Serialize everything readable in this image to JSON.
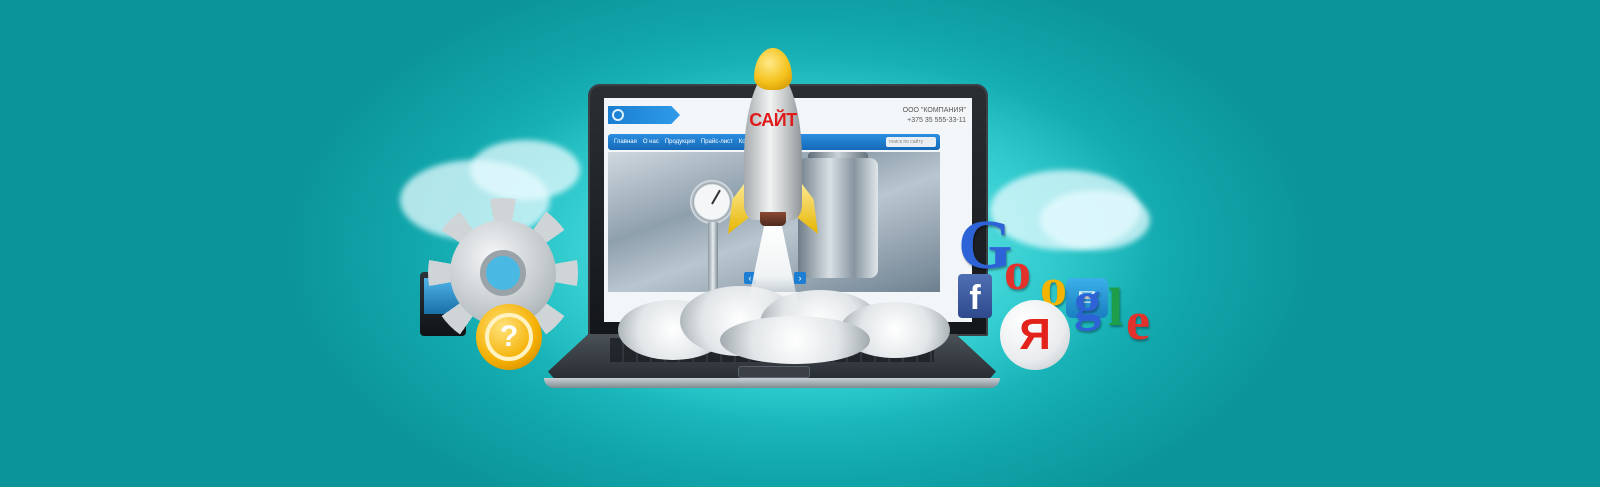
{
  "rocket": {
    "label": "САЙТ"
  },
  "website": {
    "company": "ООО \"КОМПАНИЯ\"",
    "phone": "+375 35 555-33-11",
    "nav": [
      "Главная",
      "О нас",
      "Продукция",
      "Прайс-лист",
      "Кон"
    ],
    "search_placeholder": "поиск по сайту",
    "arrow_prev": "‹",
    "arrow_next": "›"
  },
  "logos": {
    "google": [
      "G",
      "o",
      "o",
      "g",
      "l",
      "e"
    ],
    "facebook": "f",
    "yandex": "Я"
  },
  "icons": [
    "gear-icon",
    "magnifier-icon",
    "question-icon",
    "monitor-icon",
    "facebook-icon",
    "chat-icon",
    "yandex-icon",
    "rocket-icon"
  ],
  "colors": {
    "background": "#1bbcc0",
    "rocket_text": "#e01a1a",
    "nav_bar": "#1f7fcf"
  }
}
